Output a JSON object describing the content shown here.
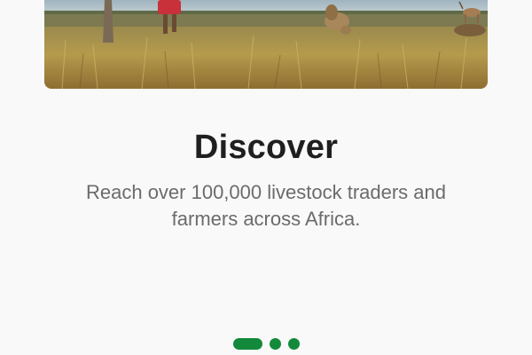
{
  "onboarding": {
    "title": "Discover",
    "subtitle": "Reach over 100,000 livestock traders and farmers across Africa.",
    "page_indicator": {
      "total": 3,
      "active_index": 0
    }
  },
  "colors": {
    "background": "#f9f9f9",
    "accent": "#138a3b",
    "title": "#1f1f1f",
    "subtitle": "#6b6b6b"
  }
}
